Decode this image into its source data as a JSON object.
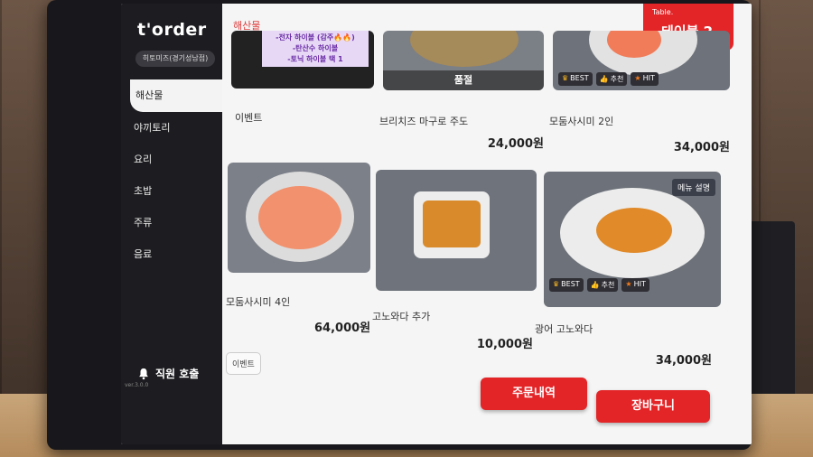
{
  "brand": "t'order",
  "store_name": "히토미즈(경기성남점)",
  "category_header": "해산물",
  "table": {
    "label": "Table.",
    "name": "테이블 2"
  },
  "sidebar": {
    "items": [
      {
        "label": "해산물",
        "active": true
      },
      {
        "label": "야끼토리"
      },
      {
        "label": "요리"
      },
      {
        "label": "초밥"
      },
      {
        "label": "주류"
      },
      {
        "label": "음료"
      }
    ],
    "call_staff": "직원 호출",
    "version": "ver.3.0.0"
  },
  "promo_lines": [
    "-전자 하이볼 (감주🔥🔥)",
    "-탄산수 하이볼",
    "-토닉 하이볼 택 1"
  ],
  "top_row": [
    {
      "name": "이벤트",
      "price": ""
    },
    {
      "name": "브리치즈 마구로 주도",
      "price": "24,000원",
      "sold_out": "품절"
    },
    {
      "name": "모둠사시미 2인",
      "price": "34,000원"
    }
  ],
  "bottom_row": [
    {
      "name": "모둠사시미 4인",
      "price": "64,000원"
    },
    {
      "name": "고노와다 추가",
      "price": "10,000원"
    },
    {
      "name": "광어 고노와다",
      "price": "34,000원",
      "menu_desc": "메뉴 설명"
    }
  ],
  "badges": {
    "best": "BEST",
    "rec": "추천",
    "hit": "HIT"
  },
  "event_chip": "이벤트",
  "buttons": {
    "order_history": "주문내역",
    "cart": "장바구니"
  }
}
